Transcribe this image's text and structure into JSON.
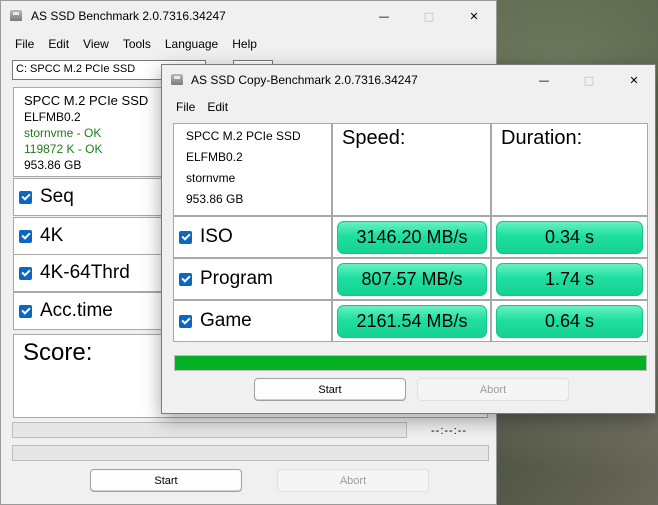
{
  "main_window": {
    "title": "AS SSD Benchmark 2.0.7316.34247",
    "menu": [
      "File",
      "Edit",
      "View",
      "Tools",
      "Language",
      "Help"
    ],
    "drive_select": "C: SPCC M.2 PCIe SSD",
    "info": {
      "model": "SPCC M.2 PCIe SSD",
      "firmware": "ELFMB0.2",
      "driver_status": "stornvme - OK",
      "alignment_status": "119872 K - OK",
      "capacity": "953.86 GB"
    },
    "tests": [
      {
        "label": "Seq",
        "checked": true
      },
      {
        "label": "4K",
        "checked": true
      },
      {
        "label": "4K-64Thrd",
        "checked": true
      },
      {
        "label": "Acc.time",
        "checked": true
      }
    ],
    "score_label": "Score:",
    "time_readout": "--:--:--",
    "start_label": "Start",
    "abort_label": "Abort"
  },
  "copy_window": {
    "title": "AS SSD Copy-Benchmark 2.0.7316.34247",
    "menu": [
      "File",
      "Edit"
    ],
    "info": {
      "model": "SPCC M.2 PCIe SSD",
      "firmware": "ELFMB0.2",
      "driver": "stornvme",
      "capacity": "953.86 GB"
    },
    "speed_header": "Speed:",
    "duration_header": "Duration:",
    "rows": [
      {
        "label": "ISO",
        "speed": "3146.20 MB/s",
        "duration": "0.34 s",
        "checked": true
      },
      {
        "label": "Program",
        "speed": "807.57 MB/s",
        "duration": "1.74 s",
        "checked": true
      },
      {
        "label": "Game",
        "speed": "2161.54 MB/s",
        "duration": "0.64 s",
        "checked": true
      }
    ],
    "progress_percent": 100,
    "start_label": "Start",
    "abort_label": "Abort"
  },
  "colors": {
    "result_green": "#1fdfa0",
    "progress_green": "#06b025",
    "checkbox_blue": "#0b67c2",
    "ok_green": "#1a7f1a"
  }
}
